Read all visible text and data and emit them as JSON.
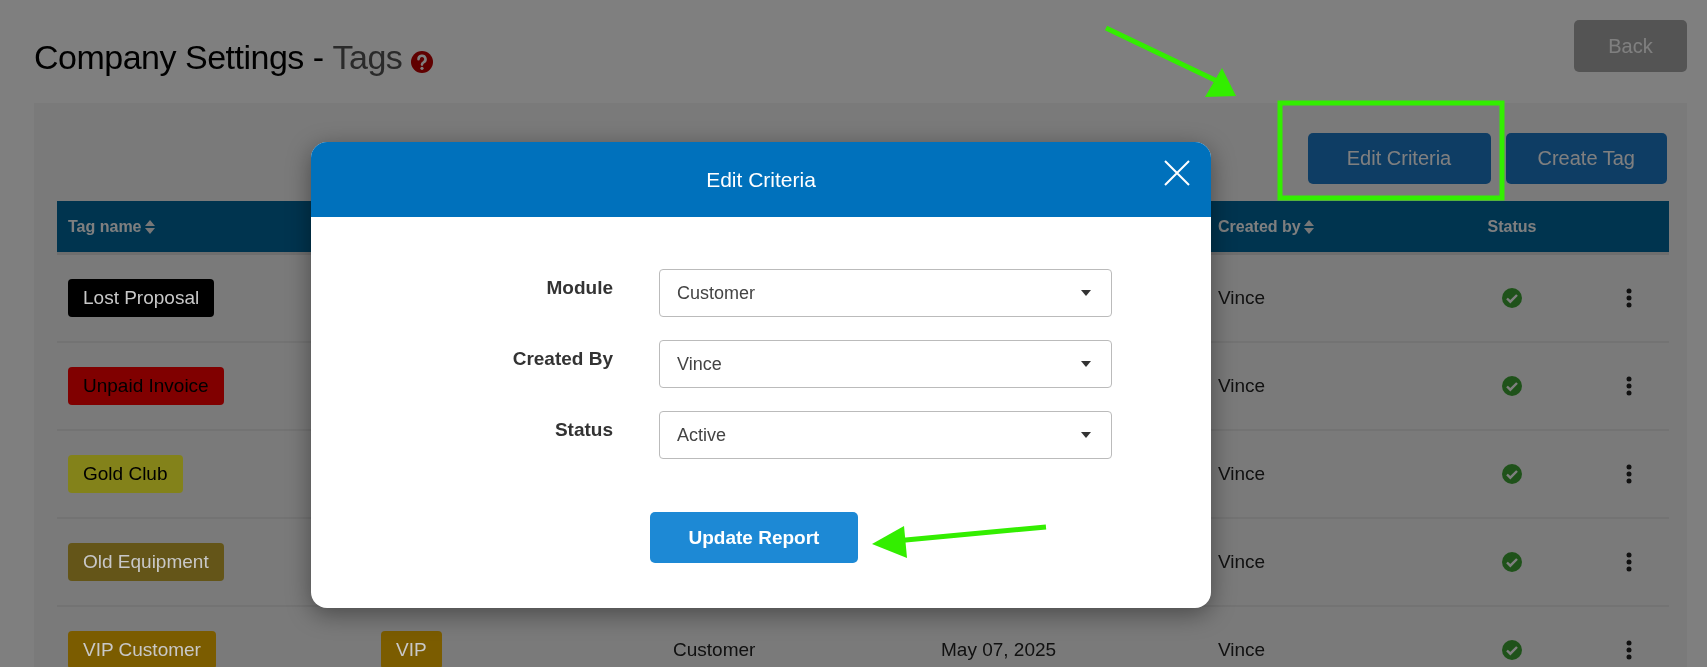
{
  "page": {
    "title": "Company Settings -",
    "subtitle": "Tags",
    "back_button": "Back"
  },
  "toolbar": {
    "buttons": [
      "Edit Criteria",
      "Create Tag"
    ]
  },
  "table": {
    "columns": [
      {
        "label": "Tag name",
        "sortable": true
      },
      {
        "label": "Created by",
        "sortable": true
      },
      {
        "label": "Status",
        "sortable": false
      }
    ],
    "rows": [
      {
        "tag": "Lost Proposal",
        "color": "#000000",
        "dark_text": false,
        "created_by": "Vince",
        "active": true
      },
      {
        "tag": "Unpaid Invoice",
        "color": "#800000",
        "dark_text": true,
        "created_by": "Vince",
        "active": true
      },
      {
        "tag": "Gold Club",
        "color": "#83821a",
        "dark_text": true,
        "created_by": "Vince",
        "active": true
      },
      {
        "tag": "Old Equipment",
        "color": "#645518",
        "dark_text": false,
        "created_by": "Vince",
        "active": true
      },
      {
        "tag": "VIP Customer",
        "color": "#7b5c00",
        "dark_text": false,
        "short_tag": "VIP",
        "module": "Customer",
        "date": "May 07, 2025",
        "created_by": "Vince",
        "active": true
      }
    ]
  },
  "dialog": {
    "title": "Edit Criteria",
    "fields": [
      {
        "label": "Module",
        "value": "Customer"
      },
      {
        "label": "Created By",
        "value": "Vince"
      },
      {
        "label": "Status",
        "value": "Active"
      }
    ],
    "submit": "Update Report"
  }
}
